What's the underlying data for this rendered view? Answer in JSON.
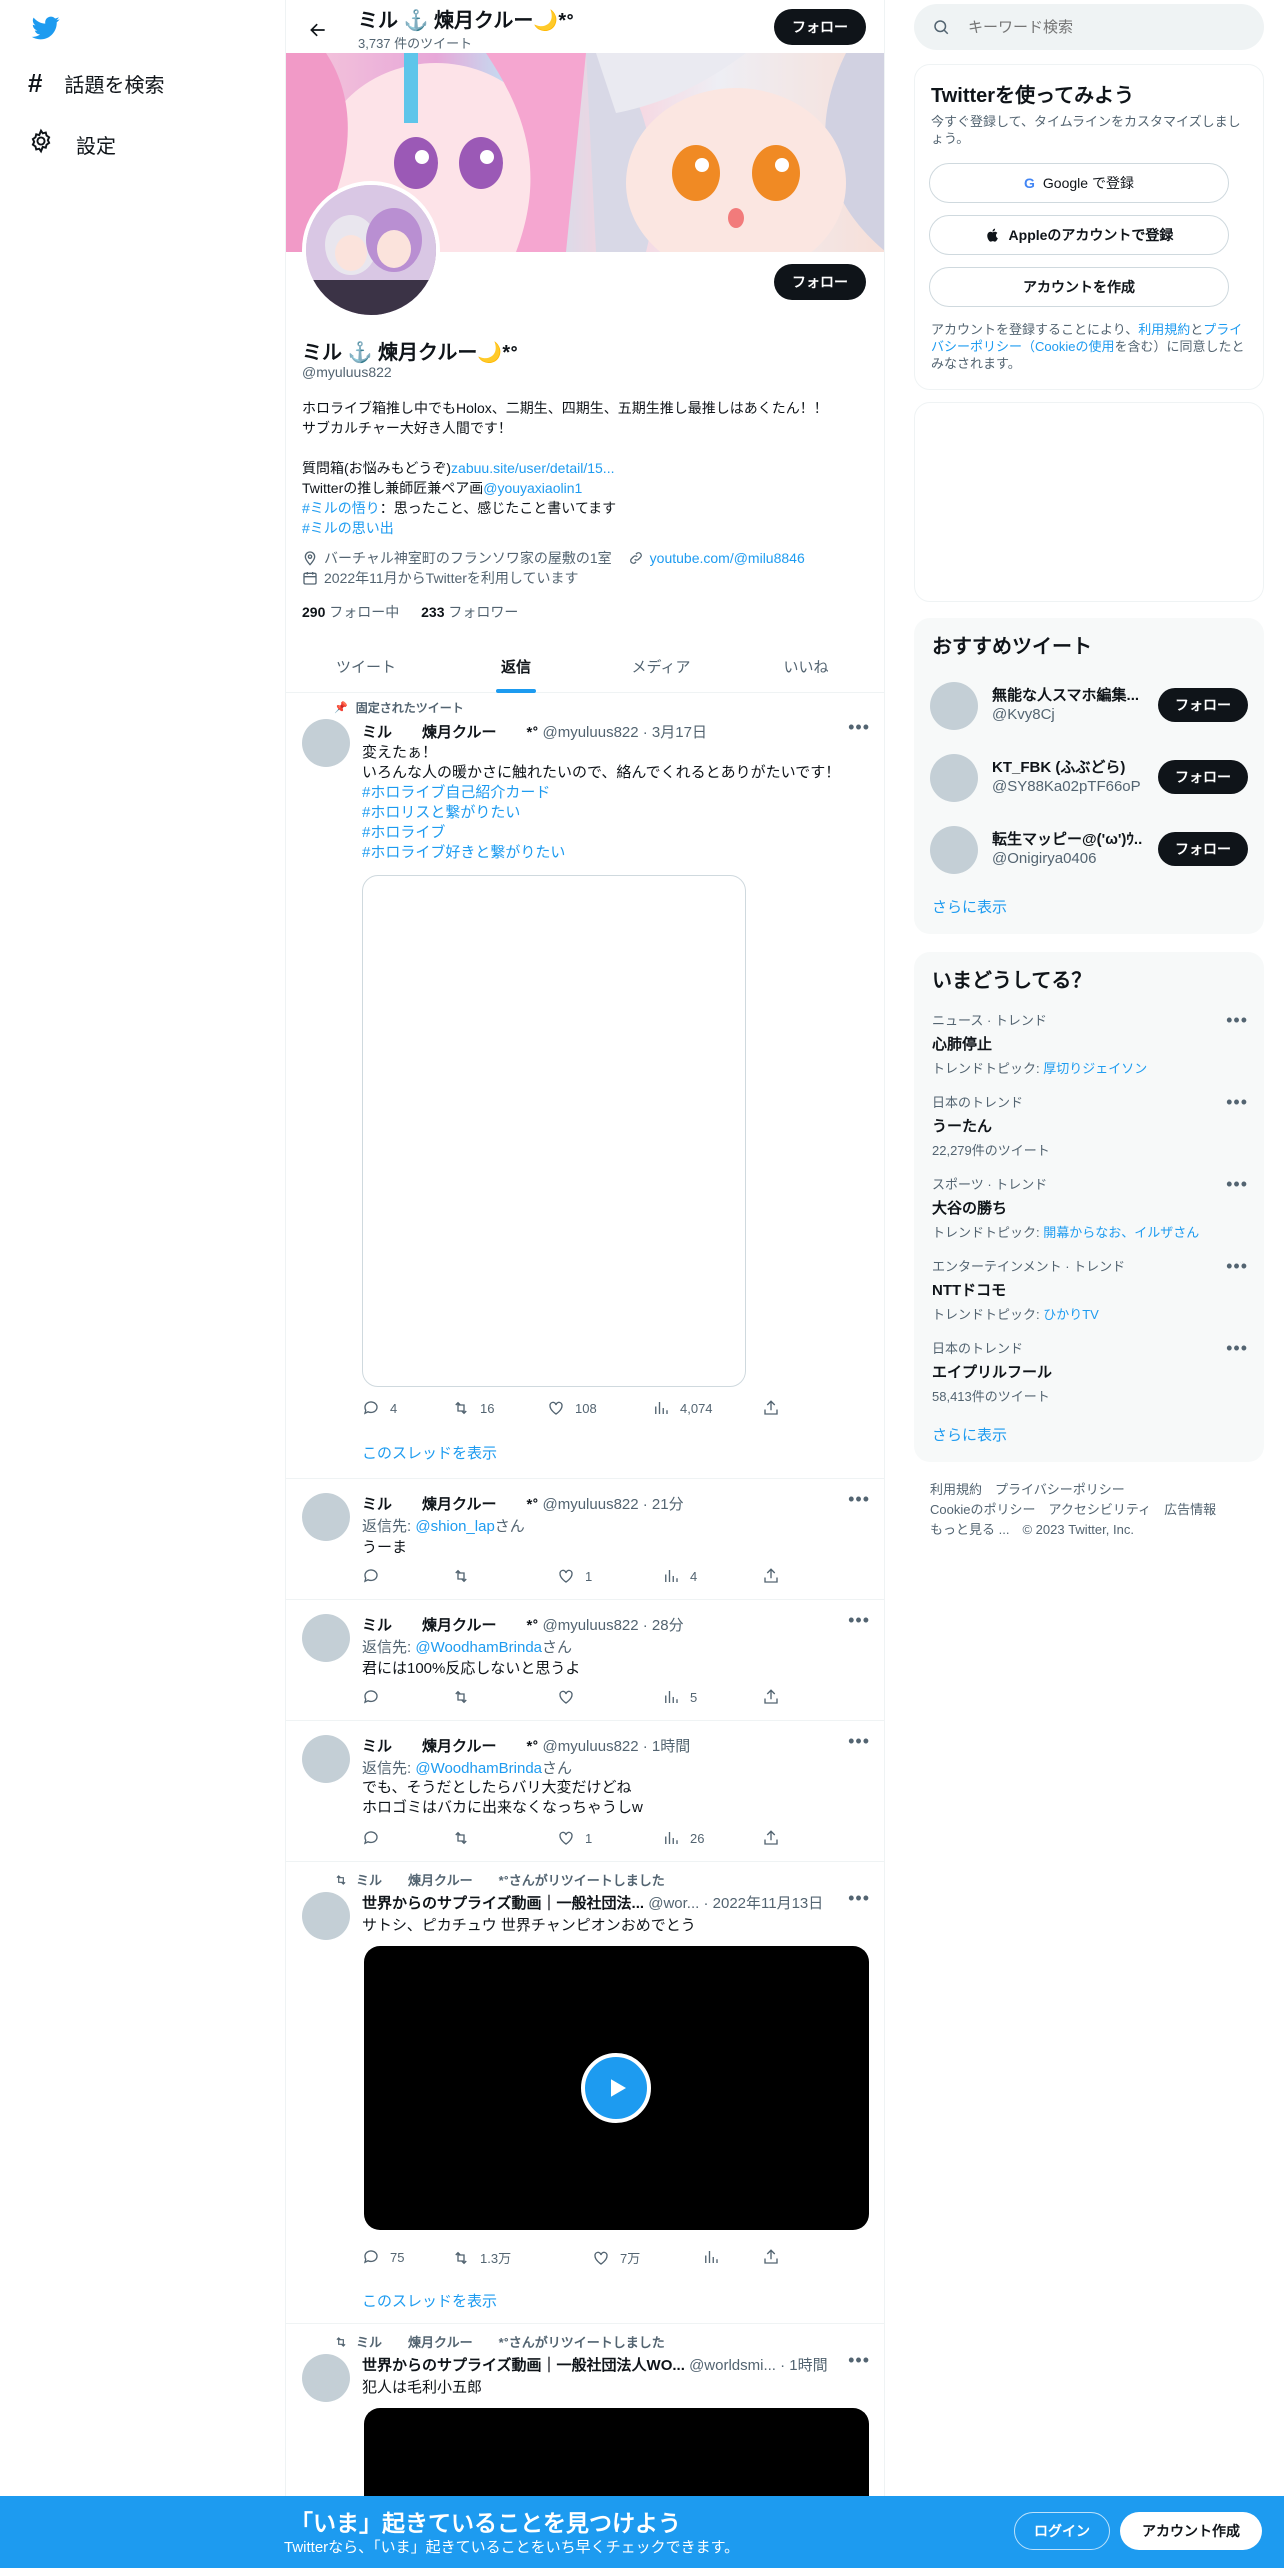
{
  "left_nav": {
    "explore_label": "話題を検索",
    "settings_label": "設定"
  },
  "header": {
    "name": "ミル ⚓️ 煉月クルー🌙*ᐤ",
    "tweet_count": "3,737 件のツイート",
    "follow_label": "フォロー"
  },
  "profile": {
    "follow_label": "フォロー",
    "name": "ミル ⚓️ 煉月クルー🌙*ᐤ",
    "handle": "@myuluus822",
    "bio_line1": "ホロライブ箱推し中でもHolox、二期生、四期生、五期生推し最推しはあくたん！！",
    "bio_line2": "サブカルチャー大好き人間です！",
    "bio_q_prefix": "質問箱(お悩みもどうぞ)",
    "bio_q_link": "zabuu.site/user/detail/15...",
    "bio_art_prefix": "Twitterの推し兼師匠兼ペア画",
    "bio_art_link": "@youyaxiaolin1",
    "bio_tag1": "#ミルの悟り",
    "bio_tag1_rest": "：思ったこと、感じたこと書いてます",
    "bio_tag2": "#ミルの思い出",
    "location": "バーチャル神室町のフランソワ家の屋敷の1室",
    "website": "youtube.com/@milu8846",
    "joined": "2022年11月からTwitterを利用しています",
    "following_count": "290",
    "following_label": "フォロー中",
    "followers_count": "233",
    "followers_label": "フォロワー"
  },
  "tabs": [
    {
      "label": "ツイート",
      "active": false
    },
    {
      "label": "返信",
      "active": true
    },
    {
      "label": "メディア",
      "active": false
    },
    {
      "label": "いいね",
      "active": false
    }
  ],
  "tweets": {
    "pinned": {
      "pinned_label": "固定されたツイート",
      "name": "ミル　　煉月クルー　　*ᐤ",
      "meta": "@myuluus822 · 3月17日",
      "line1": "変えたぁ！",
      "line2": "いろんな人の暖かさに触れたいので、絡んでくれるとありがたいです！",
      "tags": [
        "#ホロライブ自己紹介カード",
        "#ホロリスと繋がりたい",
        "#ホロライブ",
        "#ホロライブ好きと繋がりたい"
      ],
      "replies": "4",
      "retweets": "16",
      "likes": "108",
      "views": "4,074",
      "thread_label": "このスレッドを表示"
    },
    "t2": {
      "name": "ミル　　煉月クルー　　*ᐤ",
      "meta": "@myuluus822 · 21分",
      "reply_prefix": "返信先: ",
      "reply_to": "@shion_lap",
      "reply_suffix": "さん",
      "text": "うーま",
      "likes": "1",
      "views": "4"
    },
    "t3": {
      "name": "ミル　　煉月クルー　　*ᐤ",
      "meta": "@myuluus822 · 28分",
      "reply_prefix": "返信先: ",
      "reply_to": "@WoodhamBrinda",
      "reply_suffix": "さん",
      "text": "君には100%反応しないと思うよ",
      "views": "5"
    },
    "t4": {
      "name": "ミル　　煉月クルー　　*ᐤ",
      "meta": "@myuluus822 · 1時間",
      "reply_prefix": "返信先: ",
      "reply_to": "@WoodhamBrinda",
      "reply_suffix": "さん",
      "line1": "でも、そうだとしたらバリ大変だけどね",
      "line2": "ホロゴミはバカに出来なくなっちゃうしw",
      "likes": "1",
      "views": "26"
    },
    "t5": {
      "rt_label": "ミル　　煉月クルー　　*ᐤさんがリツイートしました",
      "name": "世界からのサプライズ動画｜一般社団法...",
      "meta": "@wor... · 2022年11月13日",
      "text": "サトシ、ピカチュウ 世界チャンピオンおめでとう",
      "replies": "75",
      "retweets": "1.3万",
      "likes": "7万",
      "thread_label": "このスレッドを表示"
    },
    "t6": {
      "rt_label": "ミル　　煉月クルー　　*ᐤさんがリツイートしました",
      "name": "世界からのサプライズ動画｜一般社団法人WO...",
      "meta": "@worldsmi... · 1時間",
      "text": "犯人は毛利小五郎"
    }
  },
  "search": {
    "placeholder": "キーワード検索"
  },
  "signup": {
    "title": "Twitterを使ってみよう",
    "subtitle": "今すぐ登録して、タイムラインをカスタマイズしましょう。",
    "google_label": "Google で登録",
    "apple_label": "Appleのアカウントで登録",
    "create_label": "アカウントを作成",
    "legal_prefix": "アカウントを登録することにより、",
    "legal_terms": "利用規約",
    "legal_and": "と",
    "legal_privacy": "プライバシーポリシー（Cookieの使用",
    "legal_suffix": "を含む）に同意したとみなされます。"
  },
  "recommended": {
    "title": "おすすめツイート",
    "follow_label": "フォロー",
    "users": [
      {
        "name": "無能な人スマホ編集...",
        "handle": "@Kvy8Cj"
      },
      {
        "name": "KT_FBK (ふぶどら)",
        "handle": "@SY88Ka02pTF66oP"
      },
      {
        "name": "転生マッピー@('ω')ｳ...",
        "handle": "@Onigirya0406"
      }
    ],
    "more_label": "さらに表示"
  },
  "trends": {
    "title": "いまどうしてる？",
    "items": [
      {
        "category": "ニュース · トレンド",
        "name": "心肺停止",
        "sub_prefix": "トレンドトピック: ",
        "sub_link": "厚切りジェイソン"
      },
      {
        "category": "日本のトレンド",
        "name": "うーたん",
        "sub": "22,279件のツイート"
      },
      {
        "category": "スポーツ · トレンド",
        "name": "大谷の勝ち",
        "sub_prefix": "トレンドトピック: ",
        "sub_link": "開幕からなお、イルザさん"
      },
      {
        "category": "エンターテインメント · トレンド",
        "name": "NTTドコモ",
        "sub_prefix": "トレンドトピック: ",
        "sub_link": "ひかりTV"
      },
      {
        "category": "日本のトレンド",
        "name": "エイプリルフール",
        "sub": "58,413件のツイート"
      }
    ],
    "more_label": "さらに表示"
  },
  "footer": {
    "terms": "利用規約",
    "privacy": "プライバシーポリシー",
    "cookie": "Cookieのポリシー",
    "accessibility": "アクセシビリティ",
    "ads": "広告情報",
    "more": "もっと見る ...",
    "copyright": "© 2023 Twitter, Inc."
  },
  "bottom_bar": {
    "title": "「いま」起きていることを見つけよう",
    "subtitle": "Twitterなら、「いま」起きていることをいち早くチェックできます。",
    "login_label": "ログイン",
    "signup_label": "アカウント作成"
  },
  "colors": {
    "accent": "#1d9bf0",
    "bottom_bar": "#1d9bf0",
    "dark_button": "#0f1419"
  }
}
